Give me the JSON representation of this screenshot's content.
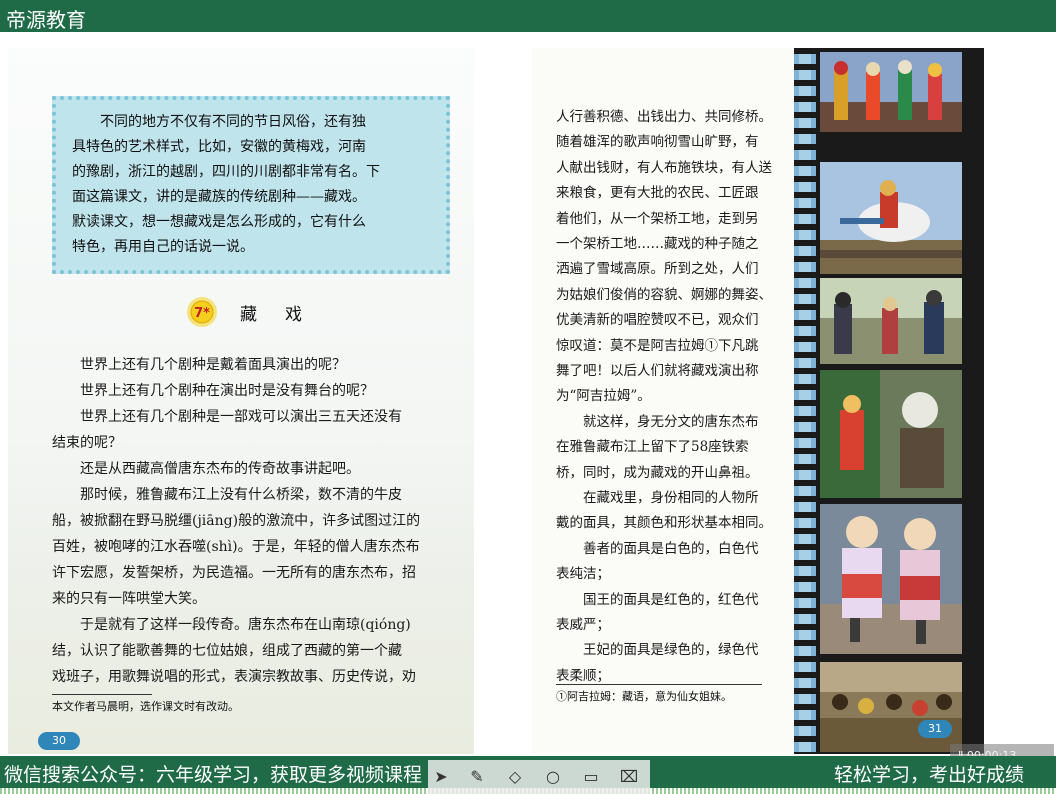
{
  "header": {
    "brand": "帝源教育"
  },
  "left_page": {
    "intro_lines": [
      "　　不同的地方不仅有不同的节日风俗，还有独",
      "具特色的艺术样式，比如，安徽的黄梅戏，河南",
      "的豫剧，浙江的越剧，四川的川剧都非常有名。下",
      "面这篇课文，讲的是藏族的传统剧种——藏戏。",
      "默读课文，想一想藏戏是怎么形成的，它有什么",
      "特色，再用自己的话说一说。"
    ],
    "lesson_number": "7*",
    "lesson_title": "藏戏",
    "body_lines": [
      "　　世界上还有几个剧种是戴着面具演出的呢？",
      "　　世界上还有几个剧种在演出时是没有舞台的呢？",
      "　　世界上还有几个剧种是一部戏可以演出三五天还没有",
      "结束的呢？",
      "　　还是从西藏高僧唐东杰布的传奇故事讲起吧。",
      "　　那时候，雅鲁藏布江上没有什么桥梁，数不清的牛皮",
      "船，被掀翻在野马脱缰(jiāng)般的激流中，许多试图过江的",
      "百姓，被咆哮的江水吞噬(shì)。于是，年轻的僧人唐东杰布",
      "许下宏愿，发誓架桥，为民造福。一无所有的唐东杰布，招",
      "来的只有一阵哄堂大笑。",
      "　　于是就有了这样一段传奇。唐东杰布在山南琼(qióng)",
      "结，认识了能歌善舞的七位姑娘，组成了西藏的第一个藏",
      "戏班子，用歌舞说唱的形式，表演宗教故事、历史传说，劝"
    ],
    "footnote": "本文作者马晨明，选作课文时有改动。",
    "page_number": "30"
  },
  "right_page": {
    "body_lines": [
      "人行善积德、出钱出力、共同修桥。",
      "随着雄浑的歌声响彻雪山旷野，有",
      "人献出钱财，有人布施铁块，有人送",
      "来粮食，更有大批的农民、工匠跟",
      "着他们，从一个架桥工地，走到另",
      "一个架桥工地……藏戏的种子随之",
      "洒遍了雪域高原。所到之处，人们",
      "为姑娘们俊俏的容貌、婀娜的舞姿、",
      "优美清新的唱腔赞叹不已，观众们",
      "惊叹道：莫不是阿吉拉姆①下凡跳",
      "舞了吧！以后人们就将藏戏演出称",
      "为“阿吉拉姆”。",
      "　　就这样，身无分文的唐东杰布",
      "在雅鲁藏布江上留下了58座铁索",
      "桥，同时，成为藏戏的开山鼻祖。",
      "　　在藏戏里，身份相同的人物所",
      "戴的面具，其颜色和形状基本相同。",
      "　　善者的面具是白色的，白色代",
      "表纯洁；",
      "　　国王的面具是红色的，红色代",
      "表威严；",
      "　　王妃的面具是绿色的，绿色代",
      "表柔顺；"
    ],
    "footnote": "①阿吉拉姆：藏语，意为仙女姐妹。",
    "page_number": "31"
  },
  "bottom_bar": {
    "left_text": "微信搜索公众号：六年级学习，获取更多视频课程",
    "right_text": "轻松学习，考出好成绩"
  },
  "player": {
    "timer": "00:00:13"
  },
  "toolbar_icons": [
    "pointer-icon",
    "pen-icon",
    "eraser-icon",
    "search-icon",
    "screen-icon",
    "qr-icon"
  ]
}
